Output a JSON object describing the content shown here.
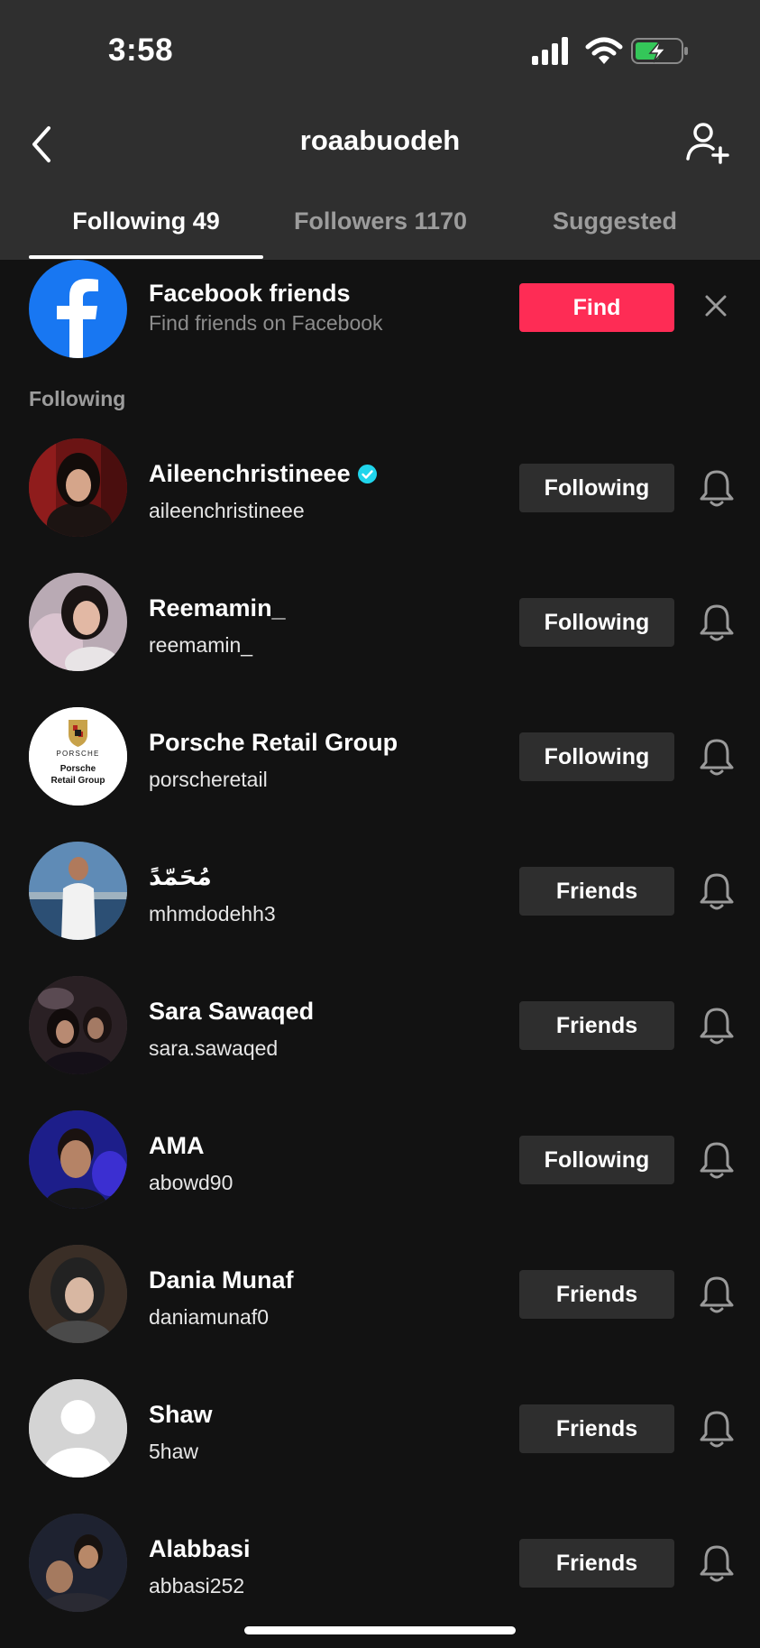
{
  "status_bar": {
    "time": "3:58"
  },
  "header": {
    "title": "roaabuodeh"
  },
  "tabs": [
    {
      "label": "Following 49",
      "active": true
    },
    {
      "label": "Followers 1170",
      "active": false
    },
    {
      "label": "Suggested",
      "active": false
    }
  ],
  "facebook_card": {
    "title": "Facebook friends",
    "subtitle": "Find friends on Facebook",
    "find_label": "Find"
  },
  "section_label": "Following",
  "users": [
    {
      "name": "Aileenchristineee",
      "handle": "aileenchristineee",
      "button": "Following",
      "verified": true
    },
    {
      "name": "Reemamin_",
      "handle": "reemamin_",
      "button": "Following",
      "verified": false
    },
    {
      "name": "Porsche Retail Group",
      "handle": "porscheretail",
      "button": "Following",
      "verified": false,
      "avatar_text": "PORSCHE",
      "avatar_caption": "Porsche Retail Group"
    },
    {
      "name": "مُحَمّدً",
      "handle": "mhmdodehh3",
      "button": "Friends",
      "verified": false
    },
    {
      "name": "Sara Sawaqed",
      "handle": "sara.sawaqed",
      "button": "Friends",
      "verified": false
    },
    {
      "name": "AMA",
      "handle": "abowd90",
      "button": "Following",
      "verified": false
    },
    {
      "name": "Dania Munaf",
      "handle": "daniamunaf0",
      "button": "Friends",
      "verified": false
    },
    {
      "name": "Shaw",
      "handle": "5haw",
      "button": "Friends",
      "verified": false
    },
    {
      "name": "Alabbasi",
      "handle": "abbasi252",
      "button": "Friends",
      "verified": false
    }
  ],
  "colors": {
    "background": "#121212",
    "header_background": "#2f2f2f",
    "find_button": "#fe2c55",
    "follow_button": "#2e2e2e",
    "verified_badge": "#20d5ec",
    "facebook_blue": "#1877f2"
  }
}
